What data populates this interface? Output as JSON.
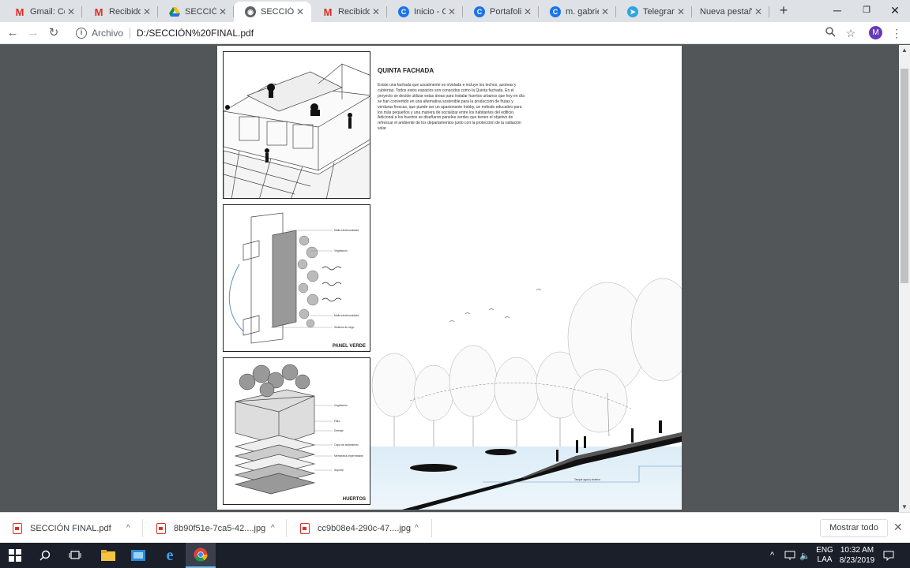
{
  "tabs": [
    {
      "title": "Gmail: Cor",
      "icon": "gmail-icon",
      "active": false
    },
    {
      "title": "Recibidos",
      "icon": "gmail-icon",
      "active": false
    },
    {
      "title": "SECCIÓN",
      "icon": "google-drive-icon",
      "active": false
    },
    {
      "title": "SECCIÓN F",
      "icon": "globe-icon",
      "active": true
    },
    {
      "title": "Recibidos",
      "icon": "gmail-icon",
      "active": false
    },
    {
      "title": "Inicio - Ca",
      "icon": "canva-icon",
      "active": false
    },
    {
      "title": "Portafolio",
      "icon": "canva-icon",
      "active": false
    },
    {
      "title": "m. gabriel",
      "icon": "canva-icon",
      "active": false
    },
    {
      "title": "Telegram",
      "icon": "telegram-icon",
      "active": false
    },
    {
      "title": "Nueva pestaña",
      "icon": "none",
      "active": false
    }
  ],
  "toolbar": {
    "security_label": "Archivo",
    "url": "D:/SECCIÓN%20FINAL.pdf",
    "profile_initial": "M"
  },
  "pdf": {
    "heading": "QUINTA FACHADA",
    "body": "Existe una fachada que usualmente es olvidada e incluye los techos, azoteas y cubiertas. Todos estos espacios son conocidos como la Quinta fachada. En el proyecto se decide utilizar estas áreas para instalar huertos urbanos que hoy en día se han convertido en una alternativa sostenible para la producción de frutas y verduras frescas, que puede ser un apasionante hobby, un método educativo para los más pequeños y una manera de socializar entre los habitantes del edificio. Adicional a los huertos se diseñaron paneles verdes que tienen el objetivo de refrescar el ambiente de los departamentos junto con la protección de la radiación solar.",
    "panel2_caption": "PANEL VERDE",
    "panel3_caption": "HUERTOS",
    "panel2_labels": [
      "Malla electrosoldada",
      "Vegetación",
      "Malla electrosoldada",
      "Sistema de riego"
    ],
    "panel3_labels": [
      "Vegetación",
      "Filtro",
      "Drenaje",
      "Capa de aislamiento",
      "Membrana Impermeable",
      "Soporte"
    ],
    "section_label": "Tanque agua y sistema"
  },
  "downloads": [
    {
      "name": "SECCIÓN FINAL.pdf"
    },
    {
      "name": "8b90f51e-7ca5-42....jpg"
    },
    {
      "name": "cc9b08e4-290c-47....jpg"
    }
  ],
  "downloads_show_all": "Mostrar todo",
  "tray": {
    "lang_top": "ENG",
    "lang_bottom": "LAA",
    "time": "10:32 AM",
    "date": "8/23/2019"
  },
  "colors": {
    "accent": "#1a73e8",
    "profile": "#673ab7",
    "taskbar": "#1b1f2a"
  }
}
